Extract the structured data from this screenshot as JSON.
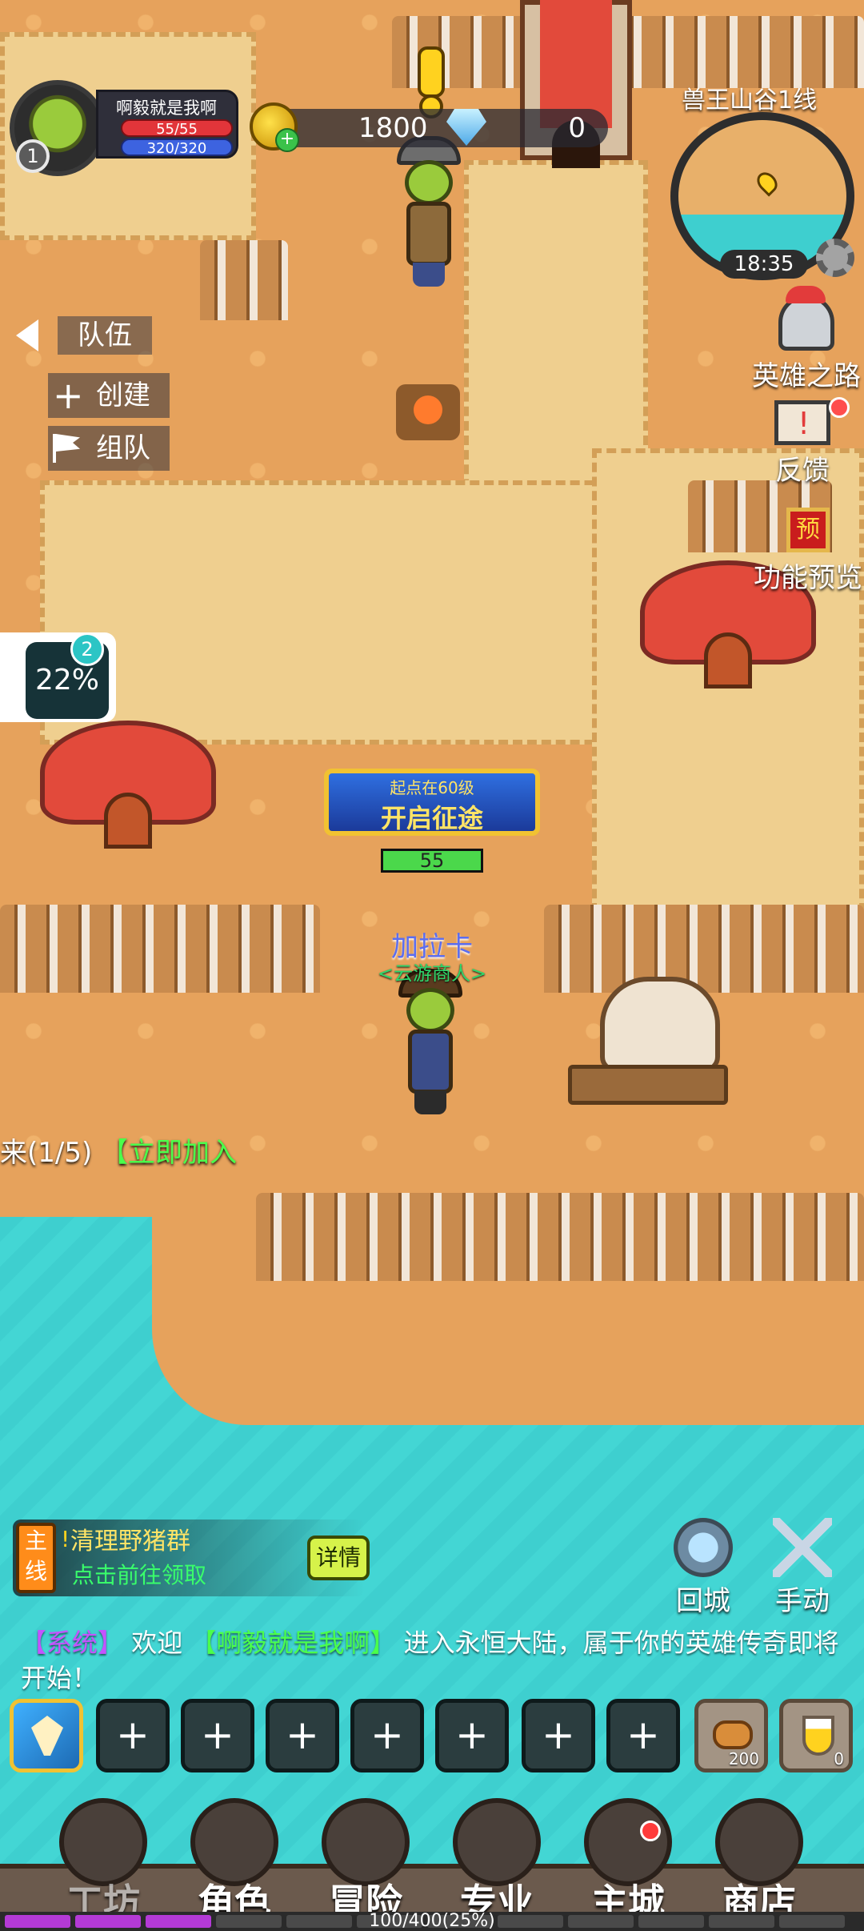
{
  "player": {
    "name": "啊毅就是我啊",
    "level": "1",
    "hp": "55/55",
    "mp": "320/320"
  },
  "currency": {
    "gold": "1800",
    "gems": "0"
  },
  "map": {
    "server": "兽王山谷1线",
    "time": "18:35"
  },
  "side_menu": {
    "hero_road": "英雄之路",
    "feedback": "反馈",
    "preview_badge": "预",
    "preview": "功能预览"
  },
  "team": {
    "title": "队伍",
    "create": "创建",
    "group": "组队",
    "invite_text": "来(1/5)",
    "invite_join": "【立即加入"
  },
  "buff": {
    "percent": "22%",
    "badge": "2"
  },
  "event": {
    "subtitle": "起点在60级",
    "title": "开启征途"
  },
  "npc": {
    "level": "55",
    "name": "加拉卡",
    "title": "<云游商人>"
  },
  "quest": {
    "tag": "主线",
    "title": "清理野猪群",
    "subtitle": "点击前往领取",
    "detail": "详情"
  },
  "actions": {
    "recall": "回城",
    "manual": "手动"
  },
  "chat": {
    "sys_tag": "【系统】",
    "prefix": "欢迎",
    "player_tag": "【啊毅就是我啊】",
    "message": "进入永恒大陆，属于你的英雄传奇即将开始！"
  },
  "skills": {
    "empty_slot": "+",
    "bread_qty": "200",
    "drink_qty": "0"
  },
  "nav": {
    "items": [
      "工坊",
      "角色",
      "冒险",
      "专业",
      "主城",
      "商店"
    ]
  },
  "exp": {
    "text": "100/400(25%)",
    "progress": 0.25
  },
  "colors": {
    "sand": "#e6a25c",
    "path": "#efcf8f",
    "water": "#3ecfcf",
    "system_purple": "#c453ff",
    "player_green": "#4bff4b",
    "exp_purple": "#b43ad6"
  }
}
